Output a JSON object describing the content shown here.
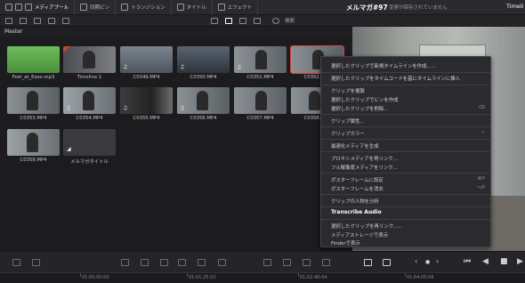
{
  "toolbar": {
    "media_pool": "メディアプール",
    "sync_bin": "同期ビン",
    "transitions": "トランジション",
    "titles": "タイトル",
    "effects": "エフェクト",
    "project_title": "メルマガ#97",
    "status": "変更が保存されていません",
    "timeline_label": "Timeli"
  },
  "search": {
    "label": "検索"
  },
  "bin": {
    "name": "Master"
  },
  "clips": [
    {
      "name": "Feel_at_Ease.mp3"
    },
    {
      "name": "Timeline 1"
    },
    {
      "name": "C0349.MP4"
    },
    {
      "name": "C0350.MP4"
    },
    {
      "name": "C0351.MP4"
    },
    {
      "name": "C0352.MP4"
    },
    {
      "name": "C0353.MP4"
    },
    {
      "name": "C0354.MP4"
    },
    {
      "name": "C0355.MP4"
    },
    {
      "name": "C0356.MP4"
    },
    {
      "name": "C0357.MP4"
    },
    {
      "name": "C0358.MP4"
    },
    {
      "name": "C0359.MP4"
    },
    {
      "name": "メルマガタイトル"
    }
  ],
  "context_menu": {
    "items": [
      {
        "label": "選択したクリップで新規タイムラインを作成......"
      },
      {
        "label": "選択したクリップをタイムコードを基にタイムラインに挿入"
      },
      {
        "label": "クリップを複製"
      },
      {
        "label": "選択したクリップでビンを作成"
      },
      {
        "label": "選択したクリップを削除...",
        "shortcut": "⌫"
      },
      {
        "label": "クリップ属性..."
      },
      {
        "label": "クリップカラー"
      },
      {
        "label": "最適化メディアを生成"
      },
      {
        "label": "プロキシメディアを再リンク..."
      },
      {
        "label": "フル解像度メディアをリンク..."
      },
      {
        "label": "ポスターフレームに設定",
        "shortcut": "⌘P"
      },
      {
        "label": "ポスターフレームを消去",
        "shortcut": "⌥P"
      },
      {
        "label": "クリップの人物を分析"
      },
      {
        "label": "Transcribe Audio"
      },
      {
        "label": "選択したクリップを再リンク......"
      },
      {
        "label": "メディアストレージで表示"
      },
      {
        "label": "Finderで表示"
      }
    ]
  },
  "timecodes": [
    "01:00:00:00",
    "01:01:25:02",
    "01:02:40:04",
    "01:04:05:06"
  ]
}
